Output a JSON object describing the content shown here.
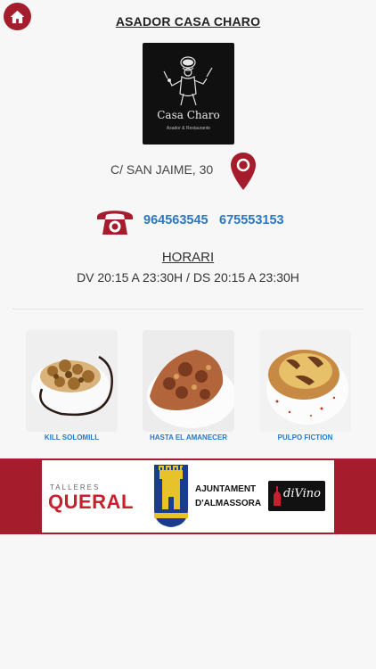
{
  "header": {
    "title": "ASADOR CASA CHARO",
    "home_icon": "home-icon"
  },
  "logo": {
    "name": "Casa Charo",
    "subtitle": "Asador & Restaurante"
  },
  "address": {
    "text": "C/ SAN JAIME, 30",
    "icon": "map-pin-icon"
  },
  "phones": {
    "icon": "telephone-icon",
    "numbers": [
      "964563545",
      "675553153"
    ]
  },
  "schedule": {
    "title": "HORARI",
    "text": "DV 20:15 A 23:30H / DS 20:15 A 23:30H"
  },
  "dishes": [
    {
      "label": "KILL SOLOMILL"
    },
    {
      "label": "HASTA EL AMANECER"
    },
    {
      "label": "PULPO FICTION"
    }
  ],
  "sponsors": {
    "queral_top": "TALLERES",
    "queral": "QUERAL",
    "ajuntament_line1": "AJUNTAMENT",
    "ajuntament_line2": "D'ALMASSORA",
    "divino": "diVino"
  },
  "colors": {
    "accent": "#a51d2d",
    "link": "#2a78c3"
  }
}
